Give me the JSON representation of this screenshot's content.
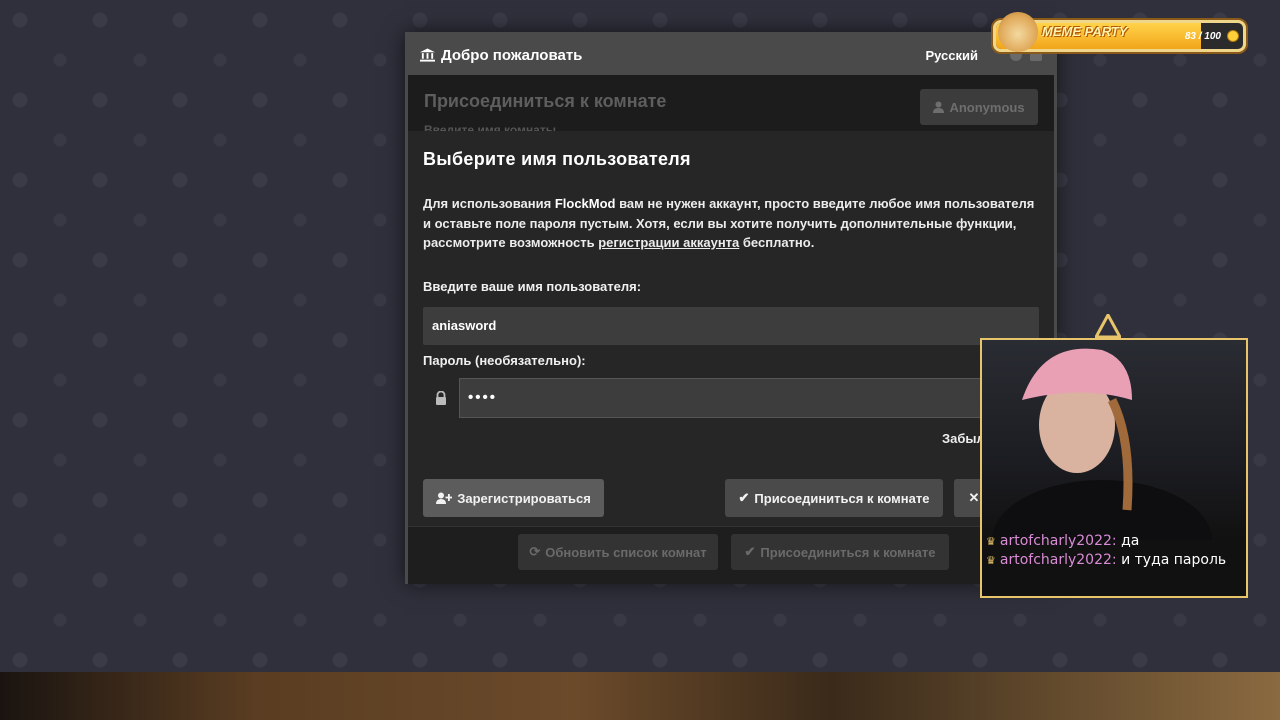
{
  "window": {
    "title": "Добро пожаловать",
    "language": "Русский"
  },
  "background_panel": {
    "heading": "Присоединиться к комнате",
    "hint": "Введите имя комнаты",
    "anon_button": "Anonymous"
  },
  "dialog": {
    "heading": "Выберите имя пользователя",
    "para_prefix": "Для использования ",
    "para_brand": "FlockMod",
    "para_middle": " вам не нужен аккаунт, просто введите любое имя пользователя и оставьте поле пароля пустым. Хотя, если вы хотите получить дополнительные функции, рассмотрите возможность ",
    "para_link": "регистрации аккаунта",
    "para_suffix": " бесплатно.",
    "username_label": "Введите ваше имя пользователя:",
    "username_value": "aniasword",
    "password_label": "Пароль (необязательно):",
    "password_value": "••••",
    "forgot": "Забыл",
    "register_button": "Зарегистрироваться",
    "join_button": "Присоединиться к комнате"
  },
  "footer": {
    "refresh_button": "Обновить список комнат",
    "join_button": "Присоединиться к комнате"
  },
  "chat": {
    "messages": [
      {
        "user": "artofcharly2022:",
        "text": "да"
      },
      {
        "user": "artofcharly2022:",
        "text": "и туда пароль"
      }
    ]
  },
  "meme_party": {
    "title": "MEME PARTY",
    "count": "83 / 100",
    "progress": 0.83
  }
}
